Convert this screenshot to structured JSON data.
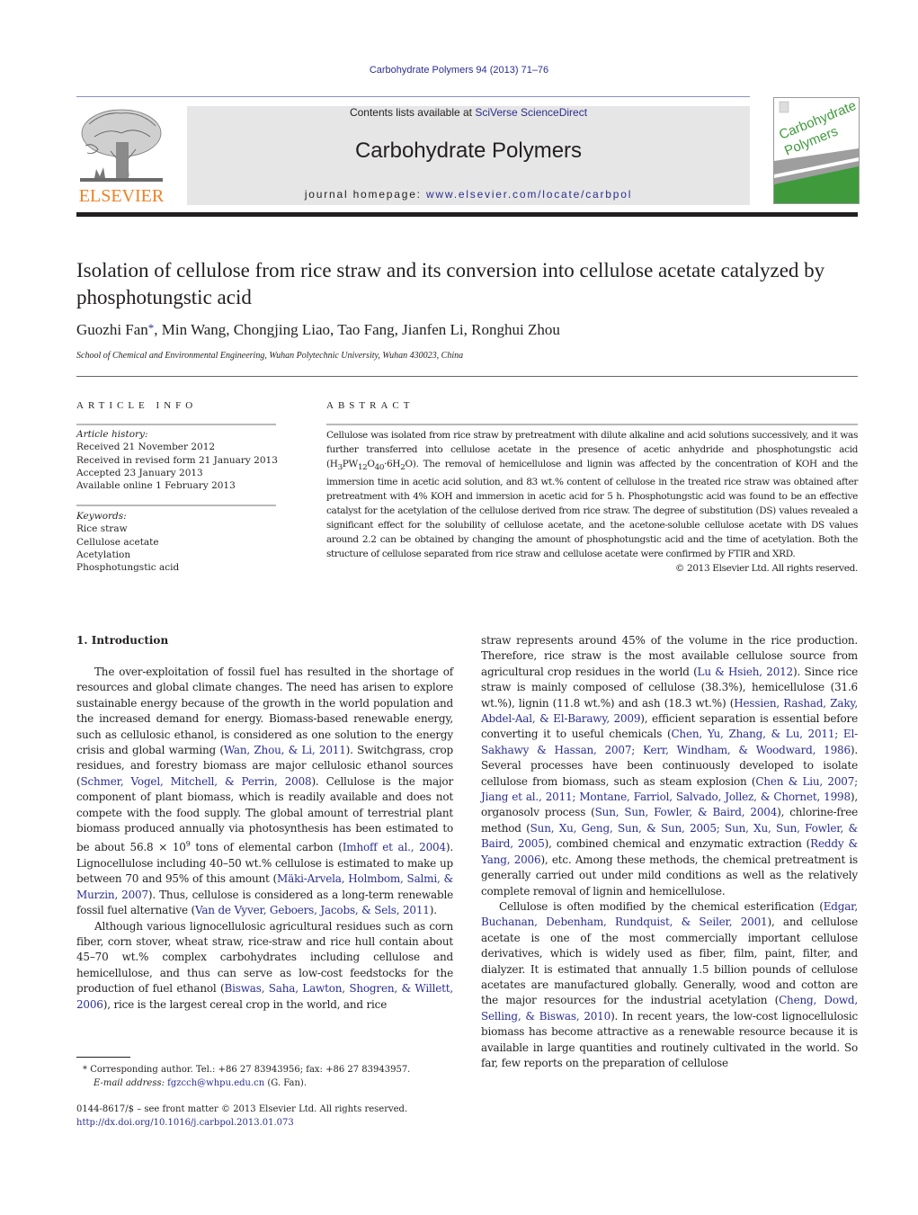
{
  "header": {
    "journal_ref": "Carbohydrate Polymers 94 (2013) 71–76",
    "contents_prefix": "Contents lists available at ",
    "contents_link": "SciVerse ScienceDirect",
    "journal_title": "Carbohydrate Polymers",
    "homepage_prefix": "journal homepage: ",
    "homepage_link": "www.elsevier.com/locate/carbpol",
    "publisher_logo_text": "ELSEVIER",
    "cover": {
      "line1": "Carbohydrate",
      "line2": "Polymers",
      "accent_color": "#3f9a3c"
    }
  },
  "article": {
    "title": "Isolation of cellulose from rice straw and its conversion into cellulose acetate catalyzed by phosphotungstic acid",
    "authors_first": "Guozhi Fan",
    "corresponding_mark": "*",
    "authors_rest": ", Min Wang, Chongjing Liao, Tao Fang, Jianfen Li, Ronghui Zhou",
    "affiliation": "School of Chemical and Environmental Engineering, Wuhan Polytechnic University, Wuhan 430023, China"
  },
  "article_info": {
    "heading": "ARTICLE INFO",
    "history_label": "Article history:",
    "history": [
      "Received 21 November 2012",
      "Received in revised form 21 January 2013",
      "Accepted 23 January 2013",
      "Available online 1 February 2013"
    ],
    "keywords_label": "Keywords:",
    "keywords": [
      "Rice straw",
      "Cellulose acetate",
      "Acetylation",
      "Phosphotungstic acid"
    ]
  },
  "abstract": {
    "heading": "ABSTRACT",
    "part1": "Cellulose was isolated from rice straw by pretreatment with dilute alkaline and acid solutions successively, and it was further transferred into cellulose acetate in the presence of acetic anhydride and phosphotungstic acid (H",
    "sub1": "3",
    "part2": "PW",
    "sub2": "12",
    "part3": "O",
    "sub3": "40",
    "part4": "·6H",
    "sub4": "2",
    "part5": "O). The removal of hemicellulose and lignin was affected by the concentration of KOH and the immersion time in acetic acid solution, and 83 wt.% content of cellulose in the treated rice straw was obtained after pretreatment with 4% KOH and immersion in acetic acid for 5 h. Phosphotungstic acid was found to be an effective catalyst for the acetylation of the cellulose derived from rice straw. The degree of substitution (DS) values revealed a significant effect for the solubility of cellulose acetate, and the acetone-soluble cellulose acetate with DS values around 2.2 can be obtained by changing the amount of phosphotungstic acid and the time of acetylation. Both the structure of cellulose separated from rice straw and cellulose acetate were confirmed by FTIR and XRD.",
    "copyright": "© 2013 Elsevier Ltd. All rights reserved."
  },
  "introduction": {
    "heading": "1.  Introduction",
    "left_p1": [
      {
        "t": "The over-exploitation of fossil fuel has resulted in the shortage of resources and global climate changes. The need has arisen to explore sustainable energy because of the growth in the world population and the increased demand for energy. Biomass-based renewable energy, such as cellulosic ethanol, is considered as one solution to the energy crisis and global warming ("
      },
      {
        "l": "Wan, Zhou, & Li, 2011"
      },
      {
        "t": "). Switchgrass, crop residues, and forestry biomass are major cellulosic ethanol sources ("
      },
      {
        "l": "Schmer, Vogel, Mitchell, & Perrin, 2008"
      },
      {
        "t": "). Cellulose is the major component of plant biomass, which is readily available and does not compete with the food supply. The global amount of terrestrial plant biomass produced annually via photosynthesis has been estimated to be about 56.8 × 10"
      },
      {
        "sup": "9"
      },
      {
        "t": " tons of elemental carbon ("
      },
      {
        "l": "Imhoff et al., 2004"
      },
      {
        "t": "). Lignocellulose including 40–50 wt.% cellulose is estimated to make up between 70 and 95% of this amount ("
      },
      {
        "l": "Mäki-Arvela, Holmbom, Salmi, & Murzin, 2007"
      },
      {
        "t": "). Thus, cellulose is considered as a long-term renewable fossil fuel alternative ("
      },
      {
        "l": "Van de Vyver, Geboers, Jacobs, & Sels, 2011"
      },
      {
        "t": ")."
      }
    ],
    "left_p2": [
      {
        "t": "Although various lignocellulosic agricultural residues such as corn fiber, corn stover, wheat straw, rice-straw and rice hull contain about 45–70 wt.% complex carbohydrates including cellulose and hemicellulose, and thus can serve as low-cost feedstocks for the production of fuel ethanol ("
      },
      {
        "l": "Biswas, Saha, Lawton, Shogren, & Willett, 2006"
      },
      {
        "t": "), rice is the largest cereal crop in the world, and rice"
      }
    ],
    "right_p1": [
      {
        "t": "straw represents around 45% of the volume in the rice production. Therefore, rice straw is the most available cellulose source from agricultural crop residues in the world ("
      },
      {
        "l": "Lu & Hsieh, 2012"
      },
      {
        "t": "). Since rice straw is mainly composed of cellulose (38.3%), hemicellulose (31.6 wt.%), lignin (11.8 wt.%) and ash (18.3 wt.%) ("
      },
      {
        "l": "Hessien, Rashad, Zaky, Abdel-Aal, & El-Barawy, 2009"
      },
      {
        "t": "), efficient separation is essential before converting it to useful chemicals ("
      },
      {
        "l": "Chen, Yu, Zhang, & Lu, 2011; El-Sakhawy & Hassan, 2007; Kerr, Windham, & Woodward, 1986"
      },
      {
        "t": "). Several processes have been continuously developed to isolate cellulose from biomass, such as steam explosion ("
      },
      {
        "l": "Chen & Liu, 2007; Jiang et al., 2011; Montane, Farriol, Salvado, Jollez, & Chornet, 1998"
      },
      {
        "t": "), organosolv process ("
      },
      {
        "l": "Sun, Sun, Fowler, & Baird, 2004"
      },
      {
        "t": "), chlorine-free method ("
      },
      {
        "l": "Sun, Xu, Geng, Sun, & Sun, 2005; Sun, Xu, Sun, Fowler, & Baird, 2005"
      },
      {
        "t": "), combined chemical and enzymatic extraction ("
      },
      {
        "l": "Reddy & Yang, 2006"
      },
      {
        "t": "), etc. Among these methods, the chemical pretreatment is generally carried out under mild conditions as well as the relatively complete removal of lignin and hemicellulose."
      }
    ],
    "right_p2": [
      {
        "t": "Cellulose is often modified by the chemical esterification ("
      },
      {
        "l": "Edgar, Buchanan, Debenham, Rundquist, & Seiler, 2001"
      },
      {
        "t": "), and cellulose acetate is one of the most commercially important cellulose derivatives, which is widely used as fiber, film, paint, filter, and dialyzer. It is estimated that annually 1.5 billion pounds of cellulose acetates are manufactured globally. Generally, wood and cotton are the major resources for the industrial acetylation ("
      },
      {
        "l": "Cheng, Dowd, Selling, & Biswas, 2010"
      },
      {
        "t": "). In recent years, the low-cost lignocellulosic biomass has become attractive as a renewable resource because it is available in large quantities and routinely cultivated in the world. So far, few reports on the preparation of cellulose"
      }
    ]
  },
  "footnote": {
    "mark": "*",
    "corresponding": "Corresponding author. Tel.: +86 27 83943956; fax: +86 27 83943957.",
    "email_label": "E-mail address: ",
    "email": "fgzcch@whpu.edu.cn",
    "email_suffix": " (G. Fan).",
    "front_matter": "0144-8617/$ – see front matter © 2013 Elsevier Ltd. All rights reserved.",
    "doi": "http://dx.doi.org/10.1016/j.carbpol.2013.01.073"
  },
  "colors": {
    "link": "#2b2f8e",
    "elsevier_orange": "#f07f22",
    "banner_gray": "#e6e6e6"
  }
}
